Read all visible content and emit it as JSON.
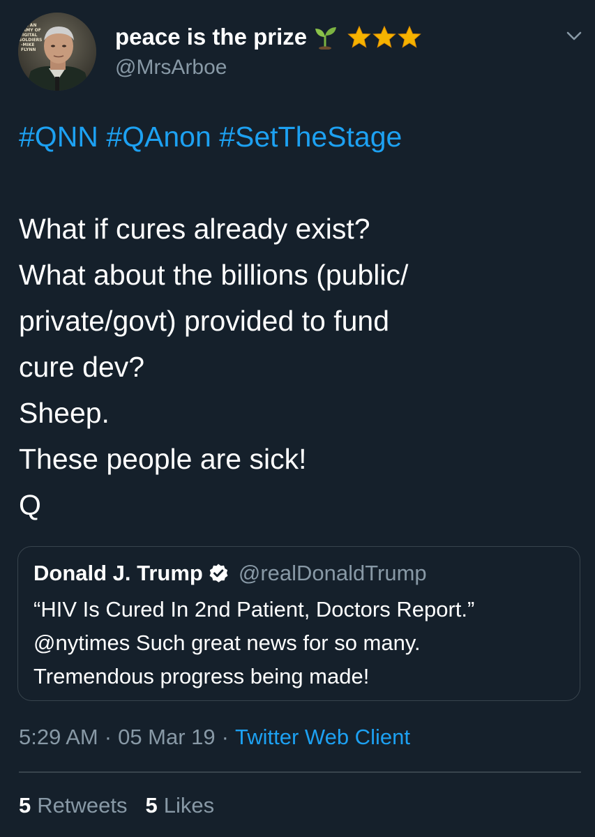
{
  "author": {
    "display_name": "peace is the prize",
    "handle": "@MrsArboe",
    "name_emoji": [
      "seedling-icon",
      "star-icon",
      "star-icon",
      "star-icon"
    ],
    "avatar_caption": "WE AN ARMY OF DIGITAL SOLDIERS -MIKE FLYNN"
  },
  "tweet": {
    "hashtags": [
      "#QNN",
      "#QAnon",
      "#SetTheStage"
    ],
    "lines": [
      "What if cures already exist?",
      "What about the billions (public/",
      "private/govt) provided to fund",
      "cure dev?",
      "Sheep.",
      "These people are sick!",
      "Q"
    ]
  },
  "quote": {
    "name": "Donald J. Trump",
    "handle": "@realDonaldTrump",
    "verified_icon": "verified-badge-icon",
    "lines": [
      "“HIV Is Cured In 2nd Patient, Doctors Report.”",
      "@nytimes  Such great news for so many.",
      "Tremendous progress being made!"
    ]
  },
  "meta": {
    "time": "5:29 AM",
    "date": "05 Mar 19",
    "separator": "·",
    "client": "Twitter Web Client"
  },
  "stats": {
    "retweets_count": "5",
    "retweets_label": "Retweets",
    "likes_count": "5",
    "likes_label": "Likes"
  },
  "colors": {
    "background": "#15202b",
    "link": "#1da1f2",
    "secondary_text": "#8899a6",
    "border": "#38444d",
    "star": "#f5b300",
    "seedling": "#7cb342"
  }
}
